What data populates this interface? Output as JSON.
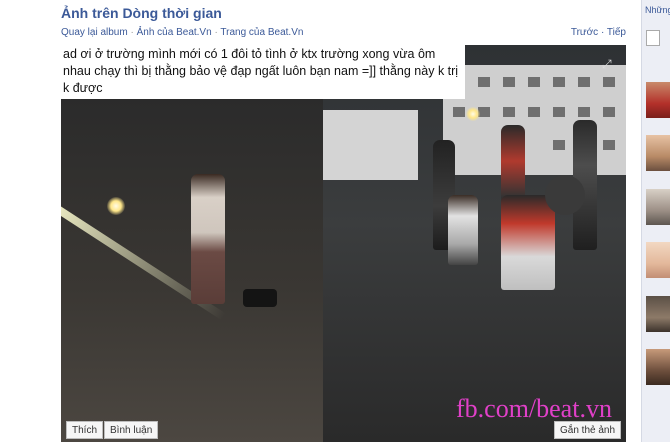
{
  "header": {
    "title": "Ảnh trên Dòng thời gian",
    "breadcrumbs": [
      "Quay lại album",
      "Ảnh của Beat.Vn",
      "Trang của Beat.Vn"
    ],
    "separator": "·",
    "prev_label": "Trước",
    "next_label": "Tiếp"
  },
  "photo": {
    "caption": "ad ơi ở trường mình  mới có 1 đôi tỏ tình ở ktx trường xong vừa ôm nhau chạy thì bị thằng bảo vệ đạp ngất luôn bạn nam =]] thằng này k trị k được",
    "watermark": "fb.com/beat.vn",
    "like_label": "Thích",
    "comment_label": "Bình luận",
    "tag_label": "Gắn thẻ ảnh",
    "fullscreen_icon": "expand-icon"
  },
  "sidebar": {
    "heading": "Những",
    "thumbnail_count": 6
  }
}
